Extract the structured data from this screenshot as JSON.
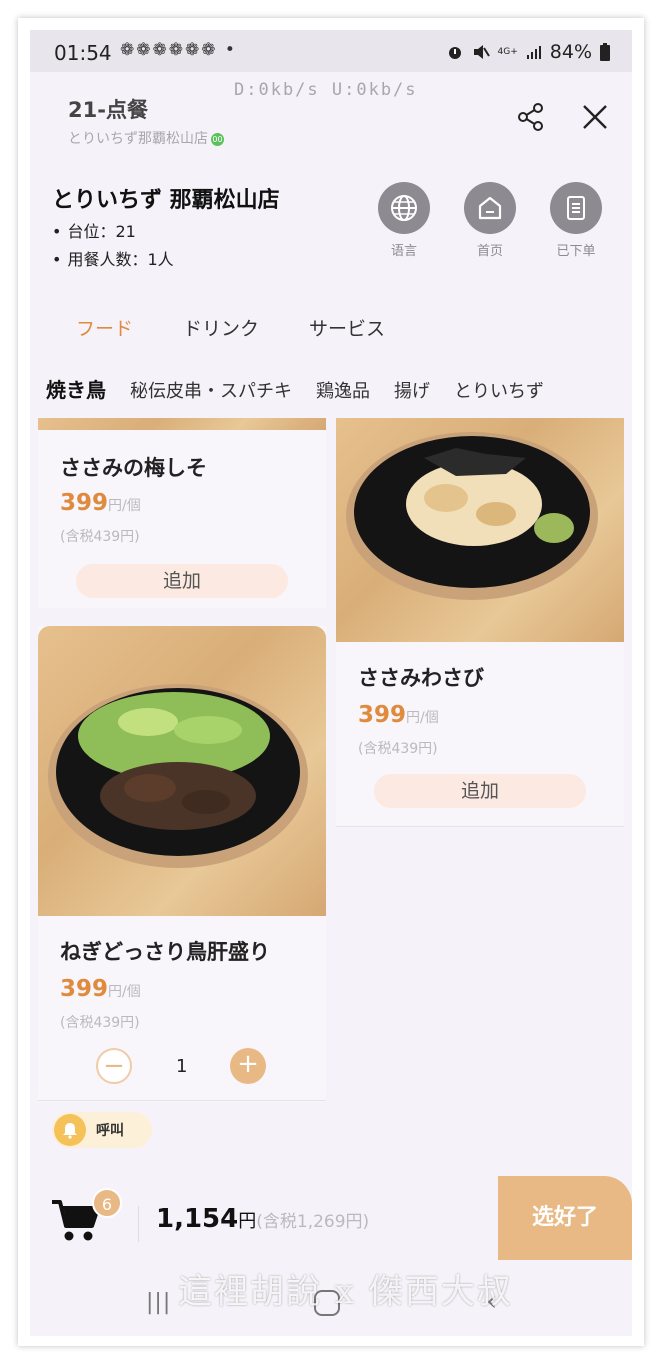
{
  "status_bar": {
    "time": "01:54",
    "notification_icons": "❁❁❁❁❁❁ •",
    "network_label": "4G+",
    "battery": "84%",
    "net_speed": "D:0kb/s  U:0kb/s"
  },
  "header": {
    "title": "21-点餐",
    "subtitle": "とりいちず那覇松山店",
    "verified_badge": "00"
  },
  "store": {
    "name": "とりいちず 那覇松山店",
    "table": "台位：21",
    "guests": "用餐人数：1人"
  },
  "quick_actions": [
    {
      "label": "语言",
      "icon": "globe-icon"
    },
    {
      "label": "首页",
      "icon": "home-icon"
    },
    {
      "label": "已下单",
      "icon": "receipt-icon"
    }
  ],
  "top_tabs": [
    "フード",
    "ドリンク",
    "サービス"
  ],
  "sub_tabs": [
    "焼き鳥",
    "秘伝皮串・スパチキ",
    "鶏逸品",
    "揚げ",
    "とりいちず"
  ],
  "menu": {
    "item1": {
      "name": "ささみの梅しそ",
      "price": "399",
      "unit": "円/個",
      "tax": "(含税439円)",
      "action": "追加"
    },
    "item2": {
      "name": "ささみわさび",
      "price": "399",
      "unit": "円/個",
      "tax": "(含税439円)",
      "action": "追加"
    },
    "item3": {
      "name": "ねぎどっさり鳥肝盛り",
      "price": "399",
      "unit": "円/個",
      "tax": "(含税439円)",
      "quantity": "1"
    }
  },
  "call_button": "呼叫",
  "cart": {
    "count": "6",
    "total": "1,154",
    "unit": "円",
    "taxed": "(含税1,269円)",
    "confirm": "选好了"
  },
  "watermark": "這裡胡說 x 傑西大叔",
  "colors": {
    "accent": "#e08a3e",
    "button": "#e9b985",
    "background": "#f6f2fa"
  }
}
